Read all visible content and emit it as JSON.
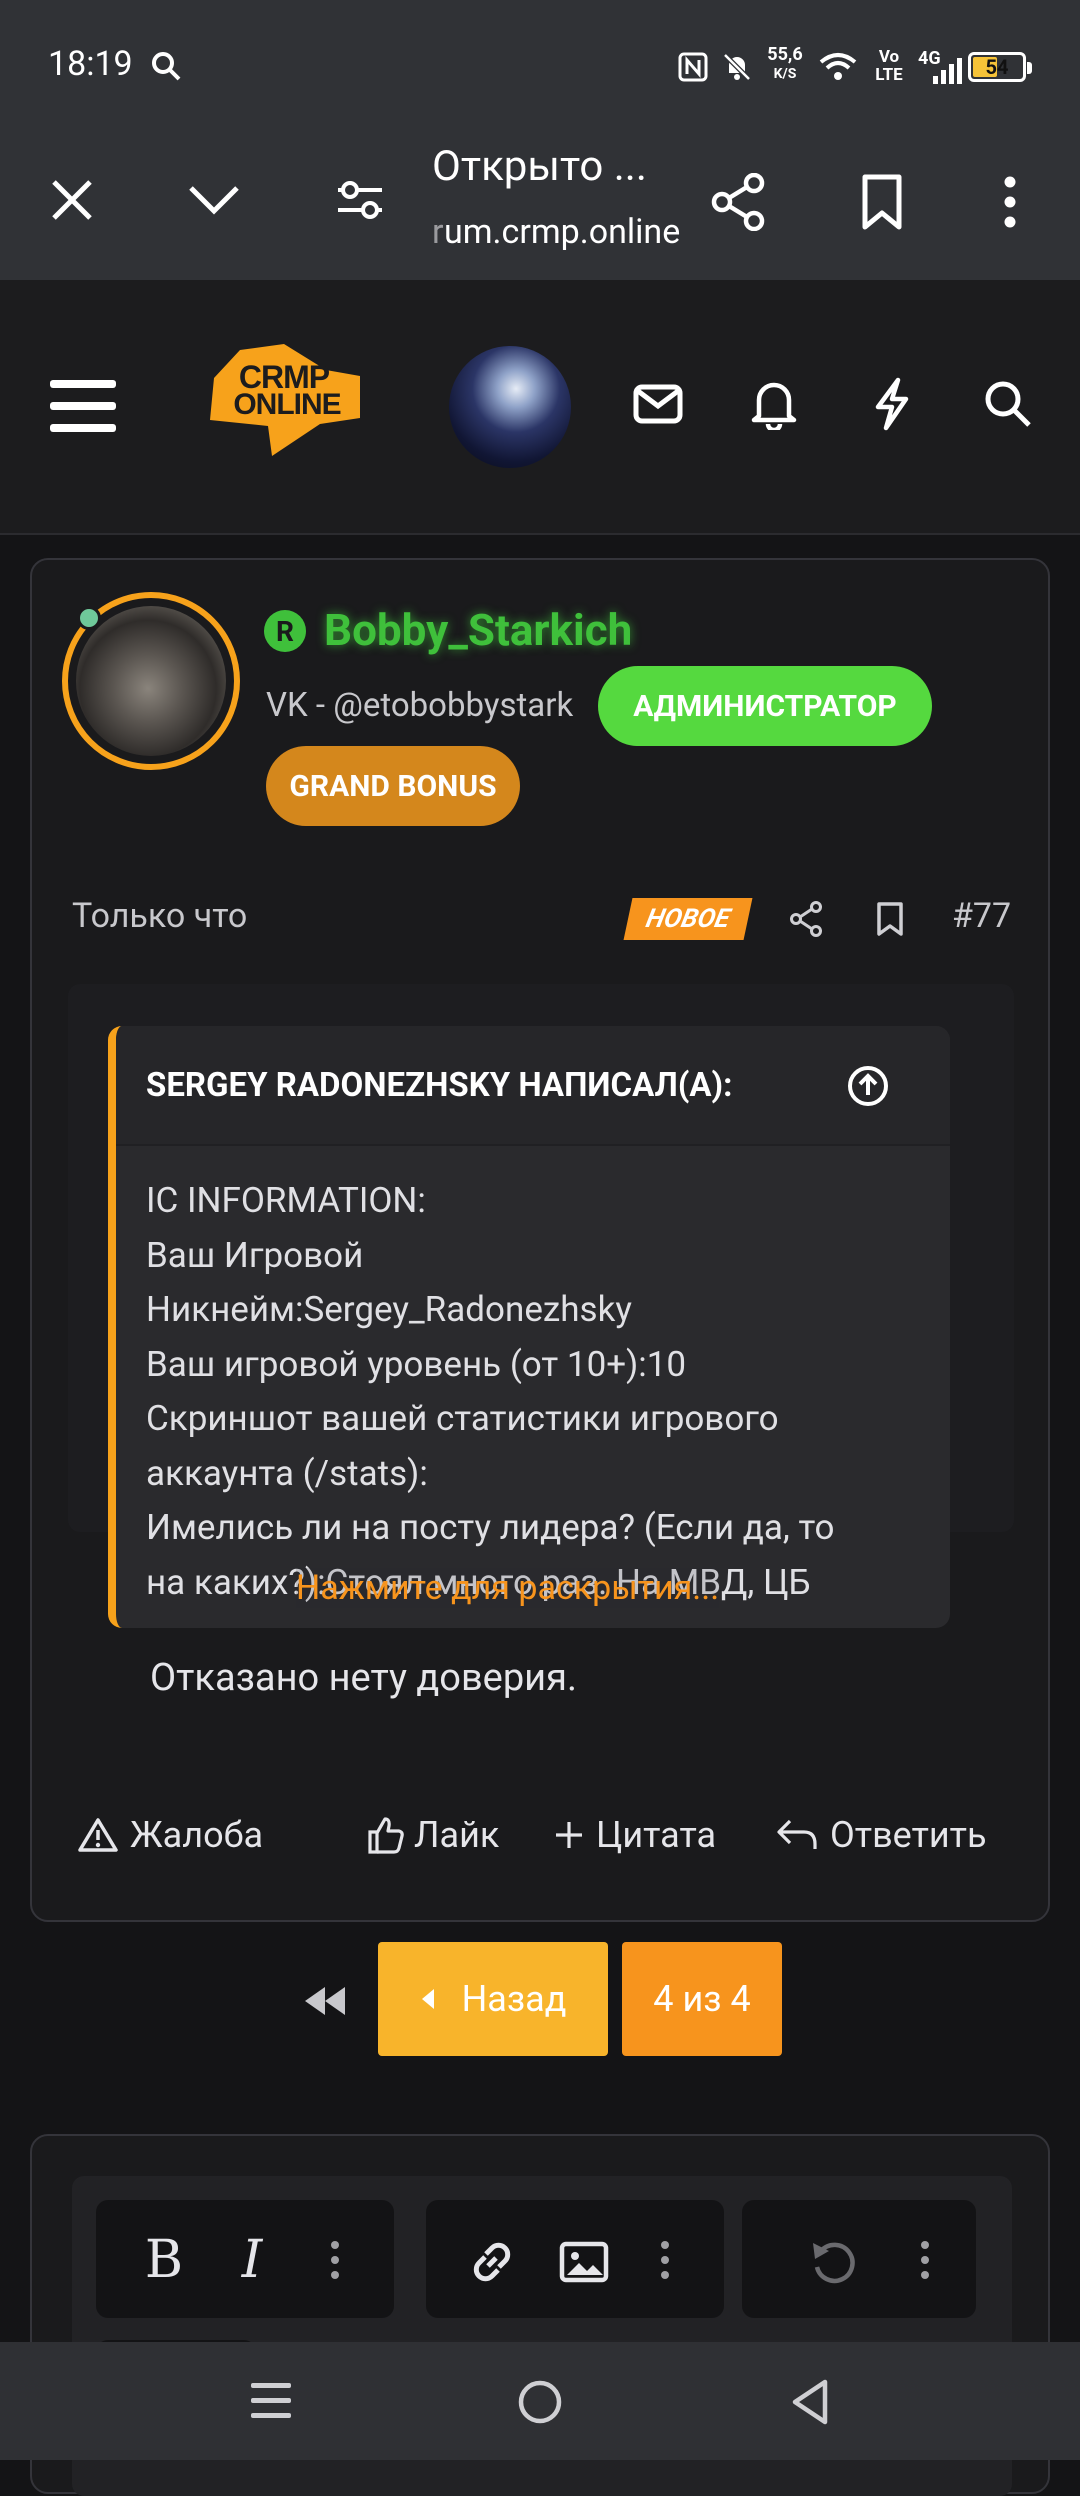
{
  "status": {
    "time": "18:19",
    "net_speed_top": "55,6",
    "net_speed_bottom": "K/S",
    "volte_top": "Vo",
    "volte_bottom": "LTE",
    "network": "4G",
    "battery": "54"
  },
  "browser": {
    "title": "Открыто ...",
    "url_faded": "r",
    "url": "um.crmp.online"
  },
  "site": {
    "logo_top": "CRMP",
    "logo_bottom": "ONLINE"
  },
  "post": {
    "author": "Bobby_Starkich",
    "author_badge": "R",
    "subtitle": "VK - @etobobbystark",
    "role_badge": "АДМИНИСТРАТОР",
    "bonus_badge": "GRAND BONUS",
    "time": "Только что",
    "new_label": "НОВОЕ",
    "number": "#77",
    "quote": {
      "header": "SERGEY RADONEZHSKY НАПИСАЛ(А):",
      "lines": [
        "IC INFORMATION:",
        "Ваш Игровой",
        "Никнейм:Sergey_Radonezhsky",
        "Ваш игровой уровень (от 10+):10",
        "Скриншот вашей статистики игрового",
        "аккаунта (/stats):",
        "Имелись ли на посту лидера? (Если да, то",
        "на каких?):Стоял много раз. На МВД, ЦБ"
      ],
      "expand": "Нажмите для раскрытия..."
    },
    "body": "Отказано нету доверия.",
    "actions": {
      "report": "Жалоба",
      "like": "Лайк",
      "quote": "Цитата",
      "reply": "Ответить"
    }
  },
  "pagination": {
    "back": "Назад",
    "current": "4 из 4"
  }
}
